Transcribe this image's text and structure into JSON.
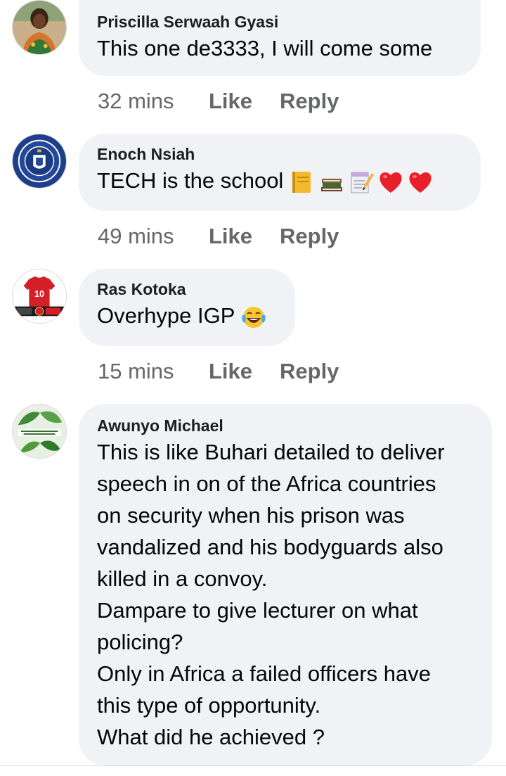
{
  "comments": [
    {
      "author": "Priscilla Serwaah Gyasi",
      "text": "This one de3333, I will come some",
      "time": "32 mins",
      "like_label": "Like",
      "reply_label": "Reply"
    },
    {
      "author": "Enoch Nsiah",
      "text": "TECH is the school",
      "emojis": [
        "ledger-emoji",
        "books-emoji",
        "memo-emoji",
        "red-heart-emoji",
        "red-heart-emoji"
      ],
      "time": "49 mins",
      "like_label": "Like",
      "reply_label": "Reply"
    },
    {
      "author": "Ras Kotoka",
      "text": "Overhype IGP",
      "emojis": [
        "tears-of-joy-emoji"
      ],
      "time": "15 mins",
      "like_label": "Like",
      "reply_label": "Reply"
    },
    {
      "author": "Awunyo Michael",
      "text": "This is like Buhari detailed to deliver\nspeech in on of the Africa countries\non security when his prison was\nvandalized and his bodyguards also\nkilled in a convoy.\nDampare to give lecturer on what\npolicing?\nOnly in Africa a failed officers have\nthis type of opportunity.\nWhat did he achieved ?"
    }
  ],
  "colors": {
    "bubble": "#f0f2f5",
    "meta_text": "#65676b",
    "body_text": "#050505",
    "heart": "#e8202a"
  }
}
